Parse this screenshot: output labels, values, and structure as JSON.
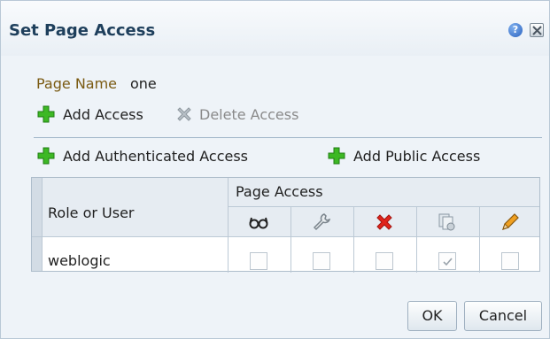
{
  "dialog": {
    "title": "Set Page Access",
    "help_icon": "question-mark-icon",
    "close_icon": "close-x-icon"
  },
  "page_name": {
    "label": "Page Name",
    "value": "one"
  },
  "actions": {
    "add_access": "Add Access",
    "delete_access": "Delete Access",
    "add_authenticated": "Add Authenticated Access",
    "add_public": "Add Public Access"
  },
  "table": {
    "role_header": "Role or User",
    "page_access_header": "Page Access",
    "permission_icons": [
      "view-glasses-icon",
      "customize-wrench-icon",
      "deny-x-icon",
      "grant-pages-icon",
      "edit-pencil-icon"
    ],
    "rows": [
      {
        "name": "weblogic",
        "permissions": [
          false,
          false,
          false,
          true,
          false
        ]
      }
    ]
  },
  "buttons": {
    "ok": "OK",
    "cancel": "Cancel"
  },
  "colors": {
    "title": "#1e3f5c",
    "page_name_label": "#7a5a12",
    "add_icon": "#3db824",
    "delete_icon": "#9aa4ad"
  }
}
